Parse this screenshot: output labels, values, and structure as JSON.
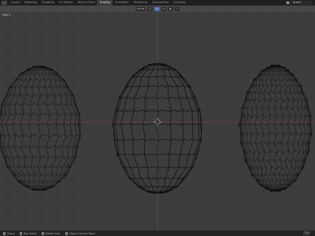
{
  "topbar": {
    "tabs": [
      "Layout",
      "Modeling",
      "Sculpting",
      "UV Editing",
      "Texture Paint",
      "Shading",
      "Animation",
      "Rendering",
      "Compositing",
      "Scripting"
    ],
    "active_tab_index": 5,
    "scene_name": "Scene"
  },
  "viewport_header": {
    "orientation_label": "Global",
    "pivot_label": "",
    "snap_label": ""
  },
  "viewport": {
    "view_label": "Side Y",
    "background_color": "#3c3c3c",
    "grid_color": "#434343",
    "x_axis_color": "#8c3f3f",
    "z_axis_color": "#3f5f8c",
    "wire_color": "#0a0a0a"
  },
  "statusbar": {
    "select_label": "Select",
    "box_select_label": "Box Select",
    "rotate_view_label": "Rotate View",
    "object_context_label": "Object Context Menu",
    "version_label": "3.6"
  }
}
